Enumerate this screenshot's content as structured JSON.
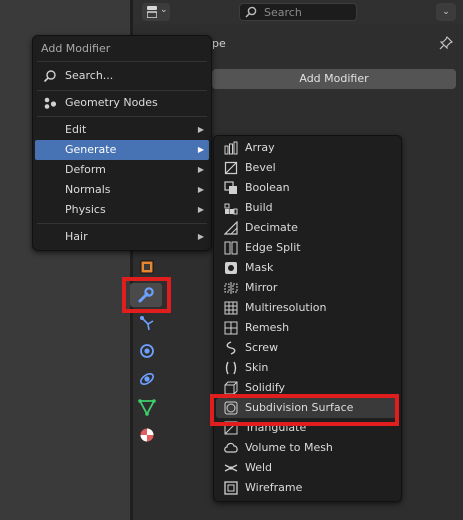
{
  "header": {
    "search_placeholder": "Search",
    "dropdown_glyph": "⌄",
    "editor_glyph": "⌄"
  },
  "panel": {
    "object_label_partial": "pe",
    "add_modifier_label": "Add Modifier"
  },
  "menu": {
    "title": "Add Modifier",
    "search_label": "Search...",
    "geometry_nodes_label": "Geometry Nodes",
    "items": [
      {
        "label": "Edit",
        "submenu": true
      },
      {
        "label": "Generate",
        "submenu": true,
        "highlighted": true
      },
      {
        "label": "Deform",
        "submenu": true
      },
      {
        "label": "Normals",
        "submenu": true
      },
      {
        "label": "Physics",
        "submenu": true
      }
    ],
    "hair_label": "Hair",
    "arrow": "▶"
  },
  "submenu": {
    "items": [
      {
        "label": "Array",
        "icon": "array-icon"
      },
      {
        "label": "Bevel",
        "icon": "bevel-icon"
      },
      {
        "label": "Boolean",
        "icon": "boolean-icon"
      },
      {
        "label": "Build",
        "icon": "build-icon"
      },
      {
        "label": "Decimate",
        "icon": "decimate-icon"
      },
      {
        "label": "Edge Split",
        "icon": "edge-split-icon"
      },
      {
        "label": "Mask",
        "icon": "mask-icon"
      },
      {
        "label": "Mirror",
        "icon": "mirror-icon"
      },
      {
        "label": "Multiresolution",
        "icon": "multiresolution-icon"
      },
      {
        "label": "Remesh",
        "icon": "remesh-icon"
      },
      {
        "label": "Screw",
        "icon": "screw-icon"
      },
      {
        "label": "Skin",
        "icon": "skin-icon"
      },
      {
        "label": "Solidify",
        "icon": "solidify-icon"
      },
      {
        "label": "Subdivision Surface",
        "icon": "subdivision-surface-icon",
        "highlighted": true
      },
      {
        "label": "Triangulate",
        "icon": "triangulate-icon"
      },
      {
        "label": "Volume to Mesh",
        "icon": "volume-to-mesh-icon"
      },
      {
        "label": "Weld",
        "icon": "weld-icon"
      },
      {
        "label": "Wireframe",
        "icon": "wireframe-icon"
      }
    ]
  },
  "colors": {
    "menu_highlight": "#4772b3",
    "annotation_red": "#e01e1e",
    "wrench_blue": "#6ea0ff"
  }
}
